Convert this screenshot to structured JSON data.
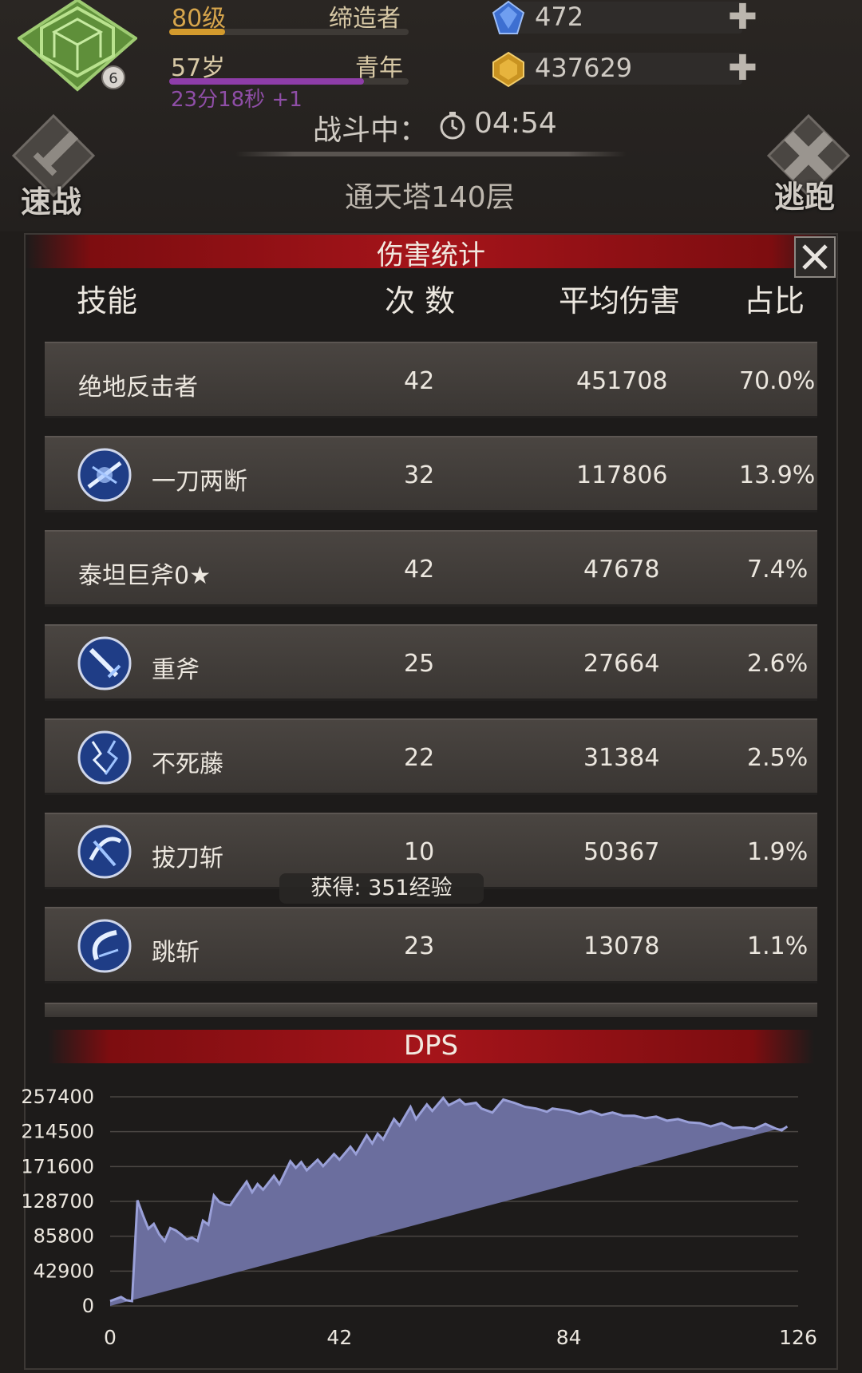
{
  "header": {
    "level": "80级",
    "title": "缔造者",
    "age": "57岁",
    "stage": "青年",
    "timer": "23分18秒 +1",
    "emblem_badge": "6",
    "gems": "472",
    "gold": "437629",
    "battle_label": "战斗中：",
    "battle_time": "04:54",
    "floor": "通天塔140层",
    "quick_battle": "速战",
    "escape": "逃跑"
  },
  "panel": {
    "title": "伤害统计",
    "columns": {
      "skill": "技能",
      "count": "次 数",
      "avg": "平均伤害",
      "ratio": "占比"
    },
    "rows": [
      {
        "name": "绝地反击者",
        "count": "42",
        "avg": "451708",
        "ratio": "70.0%",
        "icon": ""
      },
      {
        "name": "一刀两断",
        "count": "32",
        "avg": "117806",
        "ratio": "13.9%",
        "icon": "slash-burst-icon"
      },
      {
        "name": "泰坦巨斧0★",
        "count": "42",
        "avg": "47678",
        "ratio": "7.4%",
        "icon": ""
      },
      {
        "name": "重斧",
        "count": "25",
        "avg": "27664",
        "ratio": "2.6%",
        "icon": "sword-icon"
      },
      {
        "name": "不死藤",
        "count": "22",
        "avg": "31384",
        "ratio": "2.5%",
        "icon": "lightning-vine-icon"
      },
      {
        "name": "拔刀斩",
        "count": "10",
        "avg": "50367",
        "ratio": "1.9%",
        "icon": "draw-slash-icon"
      },
      {
        "name": "跳斩",
        "count": "23",
        "avg": "13078",
        "ratio": "1.1%",
        "icon": "leap-slash-icon"
      }
    ],
    "exp_toast": "获得: 351经验"
  },
  "dps": {
    "title": "DPS"
  },
  "chart_data": {
    "type": "area",
    "title": "DPS",
    "xlabel": "",
    "ylabel": "",
    "xlim": [
      0,
      126
    ],
    "ylim": [
      0,
      257400
    ],
    "yticks": [
      "257400",
      "214500",
      "171600",
      "128700",
      "85800",
      "42900",
      "0"
    ],
    "xticks": [
      "0",
      "42",
      "84",
      "126"
    ],
    "grid": true,
    "color": "#6b6e9e",
    "x": [
      0,
      2,
      3,
      4,
      5,
      6,
      7,
      8,
      9,
      10,
      11,
      12,
      13,
      14,
      15,
      16,
      17,
      18,
      19,
      20,
      21,
      22,
      23,
      25,
      26,
      27,
      28,
      30,
      31,
      33,
      34,
      35,
      36,
      38,
      39,
      41,
      42,
      44,
      45,
      47,
      48,
      49,
      50,
      52,
      53,
      55,
      56,
      58,
      59,
      61,
      62,
      64,
      65,
      67,
      68,
      70,
      72,
      74,
      76,
      78,
      80,
      81,
      84,
      86,
      88,
      90,
      92,
      94,
      96,
      98,
      100,
      102,
      104,
      106,
      108,
      110,
      112,
      114,
      116,
      118,
      120,
      122,
      123,
      124,
      126
    ],
    "y": [
      6000,
      11000,
      7000,
      6000,
      130000,
      112000,
      95000,
      101000,
      88000,
      80000,
      96000,
      93000,
      88000,
      82000,
      84000,
      80000,
      105000,
      100000,
      136000,
      128000,
      125000,
      124000,
      134000,
      153000,
      140000,
      150000,
      143000,
      160000,
      150000,
      178000,
      170000,
      177000,
      167000,
      180000,
      172000,
      187000,
      180000,
      196000,
      187000,
      210000,
      200000,
      212000,
      205000,
      230000,
      222000,
      245000,
      230000,
      248000,
      240000,
      256000,
      247000,
      254000,
      248000,
      250000,
      243000,
      238000,
      254000,
      250000,
      245000,
      243000,
      239000,
      243000,
      240000,
      236000,
      240000,
      235000,
      238000,
      234000,
      234000,
      231000,
      233000,
      228000,
      230000,
      226000,
      225000,
      221000,
      225000,
      219000,
      220000,
      218000,
      224000,
      218000,
      216000,
      221000
    ]
  }
}
